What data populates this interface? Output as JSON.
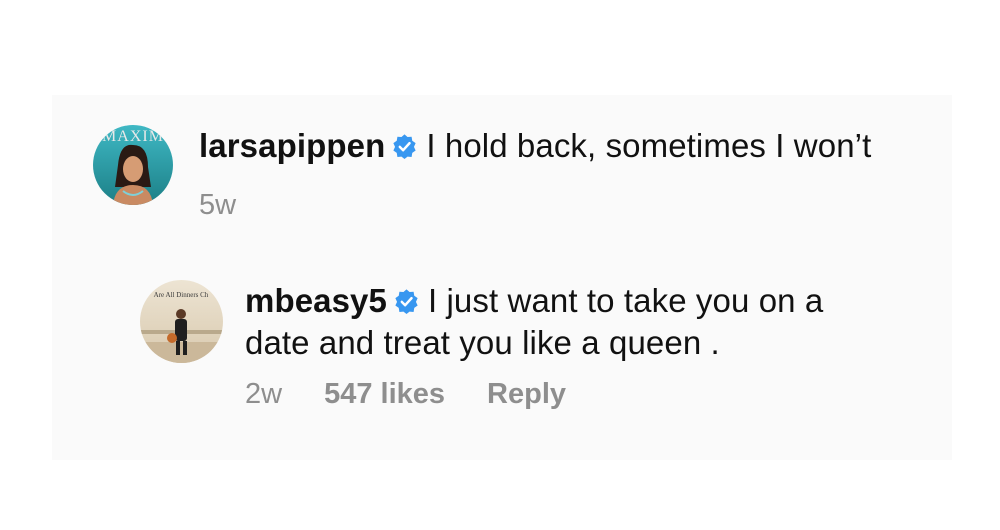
{
  "comments": [
    {
      "username": "larsapippen",
      "verified": true,
      "text": "I hold back, sometimes I won’t",
      "time": "5w",
      "avatar_icon": "magazine-cover-avatar",
      "avatar_caption": "MAXIM"
    }
  ],
  "reply": {
    "username": "mbeasy5",
    "verified": true,
    "text_line1": "I just want to take you on a",
    "text_line2": "date and treat you like a queen .",
    "time": "2w",
    "likes": "547 likes",
    "reply_label": "Reply",
    "avatar_icon": "basketball-player-avatar",
    "avatar_caption": "Are All Dinners Ch"
  },
  "colors": {
    "verified_blue": "#3897f0",
    "meta_gray": "#8e8e8e",
    "panel_bg": "#fafafa"
  }
}
